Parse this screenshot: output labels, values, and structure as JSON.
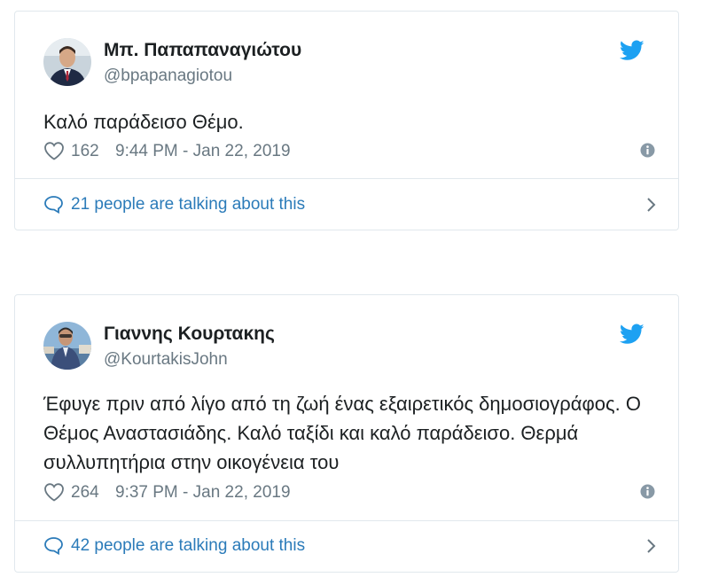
{
  "colors": {
    "twitter_blue": "#1da1f2",
    "link_blue": "#2b7bb9",
    "muted_gray": "#697882",
    "border": "#e1e8ed",
    "text": "#1c2022"
  },
  "tweets": [
    {
      "name": "Μπ. Παπαπαναγιώτου",
      "handle": "@bpapanagiotou",
      "text": "Καλό παράδεισο Θέμο.",
      "likes": "162",
      "time": "9:44 PM - Jan 22, 2019",
      "talking": "21 people are talking about this",
      "icons": {
        "avatar": "avatar",
        "bird": "twitter-bird-icon",
        "heart": "heart-icon",
        "info": "info-icon",
        "reply": "speech-bubble-icon",
        "chevron": "chevron-right-icon"
      }
    },
    {
      "name": "Γιαννης Κουρτακης",
      "handle": "@KourtakisJohn",
      "text": "Έφυγε πριν από λίγο από τη ζωή ένας εξαιρετικός δημοσιογράφος. Ο Θέμος Αναστασιάδης. Καλό ταξίδι και καλό παράδεισο. Θερμά συλλυπητήρια στην οικογένεια του",
      "likes": "264",
      "time": "9:37 PM - Jan 22, 2019",
      "talking": "42 people are talking about this",
      "icons": {
        "avatar": "avatar",
        "bird": "twitter-bird-icon",
        "heart": "heart-icon",
        "info": "info-icon",
        "reply": "speech-bubble-icon",
        "chevron": "chevron-right-icon"
      }
    }
  ]
}
